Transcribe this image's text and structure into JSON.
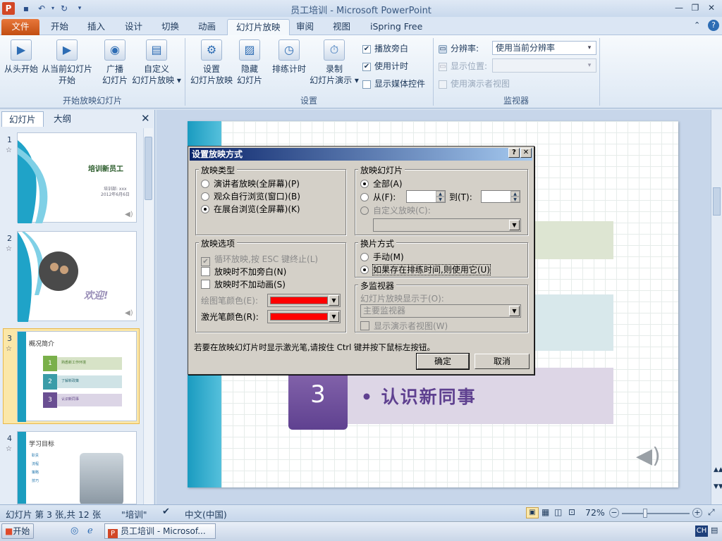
{
  "window": {
    "title": "员工培训 - Microsoft PowerPoint"
  },
  "qat": {
    "icons": [
      "powerpoint-logo-icon",
      "save-icon",
      "undo-icon",
      "redo-icon",
      "customize-qat-icon"
    ]
  },
  "tabs": [
    {
      "label": "文件"
    },
    {
      "label": "开始"
    },
    {
      "label": "插入"
    },
    {
      "label": "设计"
    },
    {
      "label": "切换"
    },
    {
      "label": "动画"
    },
    {
      "label": "幻灯片放映"
    },
    {
      "label": "审阅"
    },
    {
      "label": "视图"
    },
    {
      "label": "iSpring Free"
    }
  ],
  "ribbon": {
    "start_group": {
      "label": "开始放映幻灯片",
      "buttons": [
        {
          "line1": "从头开始",
          "line2": ""
        },
        {
          "line1": "从当前幻灯片",
          "line2": "开始"
        },
        {
          "line1": "广播",
          "line2": "幻灯片"
        },
        {
          "line1": "自定义",
          "line2": "幻灯片放映 ▾"
        }
      ]
    },
    "setup_group": {
      "label": "设置",
      "buttons": [
        {
          "line1": "设置",
          "line2": "幻灯片放映"
        },
        {
          "line1": "隐藏",
          "line2": "幻灯片"
        },
        {
          "line1": "排练计时",
          "line2": ""
        },
        {
          "line1": "录制",
          "line2": "幻灯片演示 ▾"
        }
      ],
      "checks": [
        {
          "label": "播放旁白",
          "checked": true
        },
        {
          "label": "使用计时",
          "checked": true
        },
        {
          "label": "显示媒体控件",
          "checked": false
        }
      ]
    },
    "monitor_group": {
      "label": "监视器",
      "resolution_label": "分辨率:",
      "resolution_value": "使用当前分辨率",
      "display_label": "显示位置:",
      "display_value": "",
      "presenter_view": "使用演示者视图"
    }
  },
  "pane": {
    "tabs": [
      "幻灯片",
      "大纲"
    ],
    "thumbs": [
      {
        "num": "1",
        "title": "培训新员工",
        "sub1": "培训部: xxx",
        "sub2": "2012年6月6日"
      },
      {
        "num": "2",
        "title": "欢迎!"
      },
      {
        "num": "3",
        "title": "概况简介",
        "items": [
          "熟悉新工作环境",
          "了解新政策",
          "认识新同事"
        ]
      },
      {
        "num": "4",
        "title": "学习目标",
        "items": [
          "职责",
          "流程",
          "策略",
          "技巧"
        ]
      }
    ]
  },
  "slide": {
    "number": "3",
    "text": "• 认识新同事"
  },
  "dialog": {
    "title": "设置放映方式",
    "help": "?",
    "close": "✕",
    "show_type": {
      "label": "放映类型",
      "options": [
        {
          "label": "演讲者放映(全屏幕)(P)",
          "selected": false
        },
        {
          "label": "观众自行浏览(窗口)(B)",
          "selected": false
        },
        {
          "label": "在展台浏览(全屏幕)(K)",
          "selected": true
        }
      ]
    },
    "show_slides": {
      "label": "放映幻灯片",
      "all": "全部(A)",
      "from": "从(F):",
      "to": "到(T):",
      "custom": "自定义放映(C):"
    },
    "show_options": {
      "label": "放映选项",
      "loop": "循环放映,按 ESC 键终止(L)",
      "no_narration": "放映时不加旁白(N)",
      "no_animation": "放映时不加动画(S)",
      "pen_color": "绘图笔颜色(E):",
      "laser_color": "激光笔颜色(R):",
      "pen_swatch": "#ff0000",
      "laser_swatch": "#ff0000"
    },
    "advance": {
      "label": "换片方式",
      "manual": "手动(M)",
      "timings": "如果存在排练时间,则使用它(U)"
    },
    "monitors": {
      "label": "多监视器",
      "show_on": "幻灯片放映显示于(O):",
      "value": "主要监视器",
      "presenter": "显示演示者视图(W)"
    },
    "hint": "若要在放映幻灯片时显示激光笔,请按住 Ctrl 键并按下鼠标左按钮。",
    "ok": "确定",
    "cancel": "取消"
  },
  "status": {
    "slide_info": "幻灯片 第 3 张,共 12 张",
    "theme": "\"培训\"",
    "language": "中文(中国)",
    "zoom": "72%"
  },
  "taskbar": {
    "start": "开始",
    "app": "员工培训 - Microsof...",
    "ime": "CH"
  }
}
